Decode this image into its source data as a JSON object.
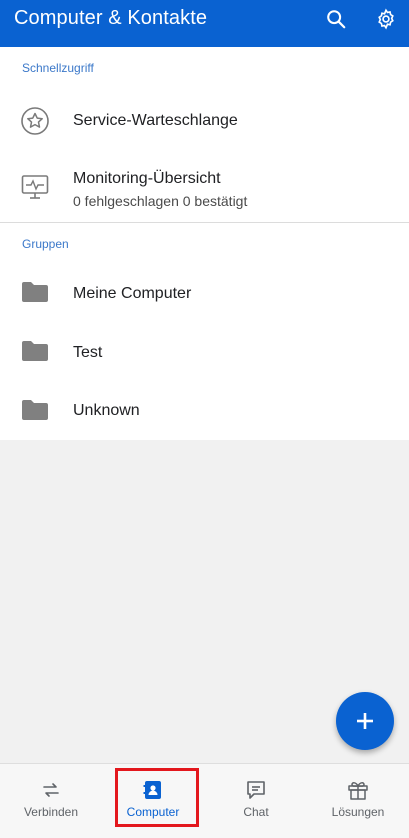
{
  "appbar": {
    "title": "Computer & Kontakte",
    "icons": [
      "search-icon",
      "gear-icon"
    ]
  },
  "quick_access": {
    "header": "Schnellzugriff",
    "items": [
      {
        "icon": "star-circle-icon",
        "label": "Service-Warteschlange"
      },
      {
        "icon": "monitor-pulse-icon",
        "label": "Monitoring-Übersicht",
        "subtitle": "0 fehlgeschlagen 0 bestätigt"
      }
    ]
  },
  "groups": {
    "header": "Gruppen",
    "items": [
      {
        "icon": "folder-icon",
        "label": "Meine Computer"
      },
      {
        "icon": "folder-icon",
        "label": "Test"
      },
      {
        "icon": "folder-icon",
        "label": "Unknown"
      }
    ]
  },
  "fab": {
    "icon": "plus-icon"
  },
  "bottom_nav": {
    "items": [
      {
        "icon": "arrows-swap-icon",
        "label": "Verbinden"
      },
      {
        "icon": "contact-book-icon",
        "label": "Computer",
        "active": true
      },
      {
        "icon": "chat-icon",
        "label": "Chat"
      },
      {
        "icon": "gift-icon",
        "label": "Lösungen"
      }
    ]
  },
  "colors": {
    "primary": "#0a62d1",
    "section_header": "#3b78c9",
    "highlight": "#e3171d"
  }
}
